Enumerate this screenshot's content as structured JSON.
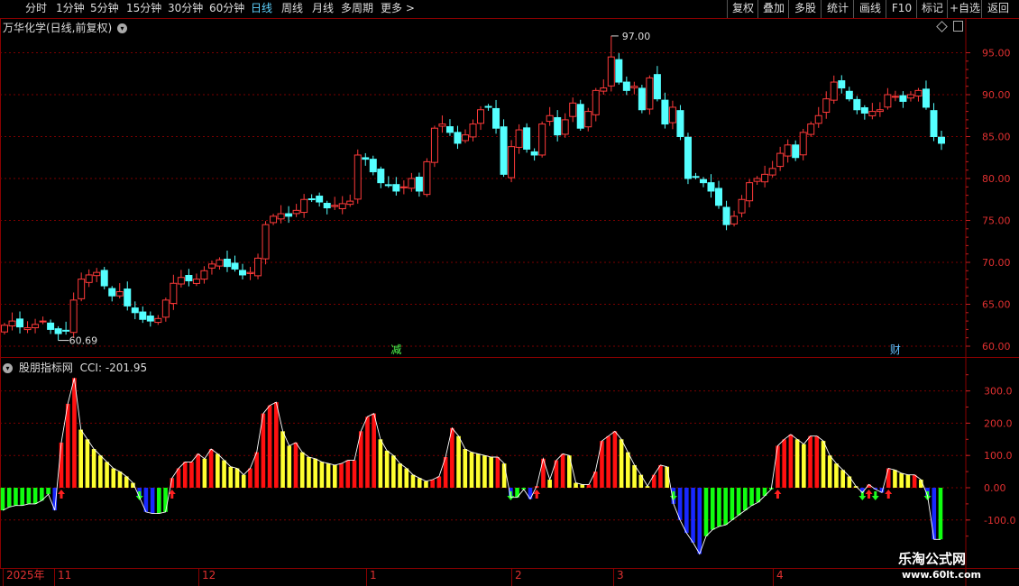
{
  "toolbar": {
    "periods": [
      "分时",
      "1分钟",
      "5分钟",
      "15分钟",
      "30分钟",
      "60分钟",
      "日线",
      "周线",
      "月线",
      "多周期",
      "更多 >"
    ],
    "active_period": "日线",
    "right_buttons": [
      "复权",
      "叠加",
      "多股",
      "统计",
      "画线",
      "F10",
      "标记",
      "+自选",
      "返回"
    ]
  },
  "main": {
    "title": "万华化学(日线,前复权)",
    "high_label": "97.00",
    "low_label": "60.69",
    "event_markers": [
      "减",
      "财"
    ],
    "y_axis_ticks": [
      "95.00",
      "90.00",
      "85.00",
      "80.00",
      "75.00",
      "70.00",
      "65.00",
      "60.00"
    ]
  },
  "indicator": {
    "title": "股朋指标网",
    "cci_label": "CCI: -201.95",
    "y_axis_ticks": [
      "300.0",
      "200.0",
      "100.0",
      "0.00",
      "-100.0"
    ]
  },
  "time_axis": {
    "labels": [
      "2025年",
      "11",
      "12",
      "1",
      "2",
      "3",
      "4"
    ]
  },
  "watermark": {
    "brand": "乐淘公式网",
    "url": "www.60lt.com"
  },
  "colors": {
    "up": "#ff3a3a",
    "down": "#54ffff",
    "cci_red": "#ff1010",
    "cci_yellow": "#ffff30",
    "cci_green": "#10ff10",
    "cci_blue": "#1828ff",
    "grid": "#7a0000"
  },
  "chart_data": [
    {
      "type": "candlestick",
      "y_range": [
        59,
        99
      ],
      "y_ticks": [
        95,
        90,
        85,
        80,
        75,
        70,
        65,
        60
      ],
      "closes": [
        62.5,
        63.0,
        62.3,
        62.2,
        62.6,
        63.0,
        62.0,
        61.5,
        61.8,
        65.5,
        68.0,
        68.5,
        68.8,
        67.2,
        66.0,
        66.5,
        64.8,
        64.0,
        63.2,
        63.0,
        63.3,
        65.5,
        67.5,
        68.2,
        67.8,
        68.0,
        69.0,
        69.8,
        70.3,
        69.5,
        69.2,
        68.5,
        68.8,
        70.5,
        74.5,
        75.5,
        75.8,
        75.5,
        76.2,
        77.5,
        77.5,
        77.2,
        76.5,
        76.8,
        77.0,
        77.3,
        82.8,
        82.3,
        80.8,
        79.5,
        79.2,
        78.5,
        79.0,
        80.0,
        78.5,
        82.0,
        86.0,
        86.5,
        85.5,
        84.2,
        85.2,
        86.5,
        88.2,
        88.5,
        86.0,
        80.5,
        83.8,
        85.8,
        83.5,
        82.8,
        86.5,
        87.5,
        85.2,
        87.0,
        89.0,
        86.0,
        88.0,
        90.5,
        90.8,
        94.5,
        91.5,
        90.5,
        91.0,
        88.2,
        92.0,
        89.5,
        86.5,
        88.5,
        85.0,
        80.0,
        80.2,
        79.5,
        78.5,
        76.8,
        74.5,
        75.5,
        77.5,
        79.5,
        80.0,
        80.5,
        81.2,
        83.0,
        84.0,
        82.5,
        85.5,
        86.5,
        87.5,
        89.5,
        91.5,
        90.8,
        89.5,
        88.2,
        87.8,
        88.0,
        88.2,
        90.0,
        89.8,
        89.2,
        90.0,
        90.5,
        88.5,
        85.0,
        84.2
      ],
      "high": 97.0,
      "low": 60.69,
      "events": [
        {
          "index": 51,
          "label": "减"
        },
        {
          "index": 116,
          "label": "财"
        }
      ]
    },
    {
      "type": "bar",
      "series": [
        {
          "name": "CCI",
          "values": [
            -70,
            -60,
            -55,
            -55,
            -50,
            -50,
            -40,
            -20,
            -70,
            140,
            260,
            340,
            180,
            150,
            120,
            100,
            80,
            60,
            50,
            35,
            15,
            -30,
            -75,
            -80,
            -80,
            -75,
            30,
            60,
            80,
            80,
            105,
            90,
            120,
            105,
            85,
            65,
            60,
            40,
            60,
            110,
            230,
            255,
            265,
            175,
            130,
            140,
            110,
            95,
            90,
            80,
            75,
            70,
            75,
            85,
            85,
            175,
            220,
            230,
            150,
            115,
            100,
            75,
            60,
            40,
            30,
            20,
            25,
            35,
            95,
            185,
            160,
            120,
            110,
            105,
            100,
            95,
            95,
            75,
            -30,
            -30,
            -5,
            -35,
            5,
            90,
            25,
            85,
            105,
            100,
            15,
            10,
            10,
            50,
            145,
            160,
            175,
            150,
            110,
            70,
            40,
            5,
            40,
            70,
            65,
            -50,
            -100,
            -140,
            -170,
            -205,
            -150,
            -130,
            -120,
            -115,
            -100,
            -85,
            -70,
            -55,
            -45,
            -25,
            -5,
            130,
            150,
            165,
            150,
            135,
            160,
            160,
            145,
            100,
            75,
            55,
            35,
            5,
            -15,
            10,
            -5,
            -15,
            60,
            55,
            45,
            40,
            40,
            25,
            -25,
            -160,
            -160
          ]
        }
      ],
      "y_range": [
        -160,
        360
      ],
      "y_ticks": [
        300,
        200,
        100,
        0,
        -100
      ],
      "last_value": -201.95
    }
  ]
}
